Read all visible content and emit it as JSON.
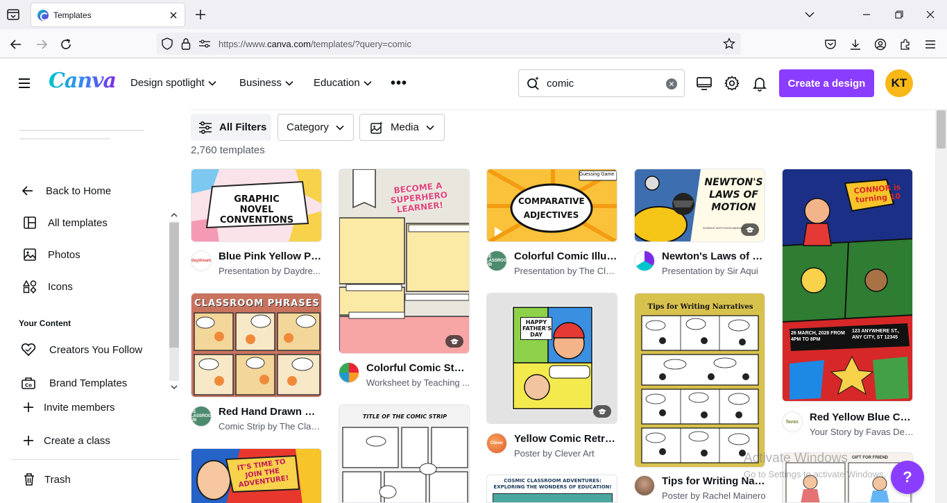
{
  "browser": {
    "tab_title": "Templates",
    "url_prefix": "https://www.",
    "url_domain": "canva.com",
    "url_rest": "/templates/?query=comic"
  },
  "header": {
    "logo": "Canva",
    "nav": [
      "Design spotlight",
      "Business",
      "Education"
    ],
    "more": "•••",
    "search_value": "comic",
    "create_button": "Create a design",
    "avatar_initials": "KT",
    "accent_color": "#8b3dff",
    "avatar_color": "#f7b818"
  },
  "sidebar": {
    "items": [
      {
        "label": "Back to Home",
        "icon": "arrow-left-icon"
      },
      {
        "label": "All templates",
        "icon": "templates-icon"
      },
      {
        "label": "Photos",
        "icon": "image-icon"
      },
      {
        "label": "Icons",
        "icon": "shapes-icon"
      }
    ],
    "your_content_heading": "Your Content",
    "content_items": [
      {
        "label": "Creators You Follow",
        "icon": "heart-icon"
      },
      {
        "label": "Brand Templates",
        "icon": "brand-icon"
      },
      {
        "label": "Invite members",
        "icon": "plus-icon"
      },
      {
        "label": "Create a class",
        "icon": "plus-icon"
      }
    ],
    "trash": "Trash"
  },
  "filters": {
    "all": "All Filters",
    "category": "Category",
    "media": "Media",
    "count": "2,760 templates"
  },
  "cards": [
    {
      "title": "Blue Pink Yellow Pas...",
      "subtitle": "Presentation by Daydre...",
      "thumb_text": "GRAPHIC NOVEL CONVENTIONS",
      "creator": "daydream"
    },
    {
      "title": "Red Hand Drawn Cl...",
      "subtitle": "Comic Strip by The Clas...",
      "thumb_text": "CLASSROOM PHRASES",
      "creator": "THE CLASSROOM PUB"
    },
    {
      "title": "Colorful Comic Styl...",
      "subtitle": "Worksheet by Teaching ...",
      "thumb_text": "BECOME A SUPERHERO LEARNER!",
      "creator": ""
    },
    {
      "title": "",
      "subtitle": "",
      "thumb_text": "TITLE OF THE COMIC STRIP",
      "creator": ""
    },
    {
      "title": "Colorful Comic Illus...",
      "subtitle": "Presentation by The Cla...",
      "thumb_text": "COMPARATIVE ADJECTIVES",
      "creator": "THE CLASSROOM PUB"
    },
    {
      "title": "Yellow Comic Retro ...",
      "subtitle": "Poster by Clever Art",
      "thumb_text": "HAPPY FATHER'S DAY",
      "creator": "Clever"
    },
    {
      "title": "",
      "subtitle": "",
      "thumb_text": "COSMIC CLASSROOM ADVENTURES: EXPLORING THE WONDERS OF EDUCATION!",
      "creator": ""
    },
    {
      "title": "Newton's Laws of M...",
      "subtitle": "Presentation by Sir Aqui",
      "thumb_text": "NEWTON'S LAWS OF MOTION",
      "creator": ""
    },
    {
      "title": "Tips for Writing Narr...",
      "subtitle": "Poster by Rachel Mainero",
      "thumb_text": "Tips for Writing Narratives",
      "creator": ""
    },
    {
      "title": "Red Yellow Blue Co...",
      "subtitle": "Your Story by Favas Des...",
      "thumb_text": "CONNOR is turning 10",
      "creator": "favas"
    },
    {
      "title": "",
      "subtitle": "",
      "thumb_text": "IT'S TIME TO JOIN THE ADVENTURE!",
      "creator": ""
    },
    {
      "title": "",
      "subtitle": "",
      "thumb_text": "GIFT FOR FRIEND",
      "creator": ""
    }
  ],
  "misc": {
    "comparative_tag": "Guessing Game",
    "newton_sub": "SCIENCE WITH ROSA MARIA ACOSTA",
    "connor_date": "26 MARCH, 2028 FROM 4PM TO 8PM",
    "connor_address": "123 ANYWHERE ST., ANY CITY, ST 12345",
    "watermark": "Activate Windows",
    "watermark_sub": "Go to Settings to activate Windows.",
    "help": "?"
  }
}
